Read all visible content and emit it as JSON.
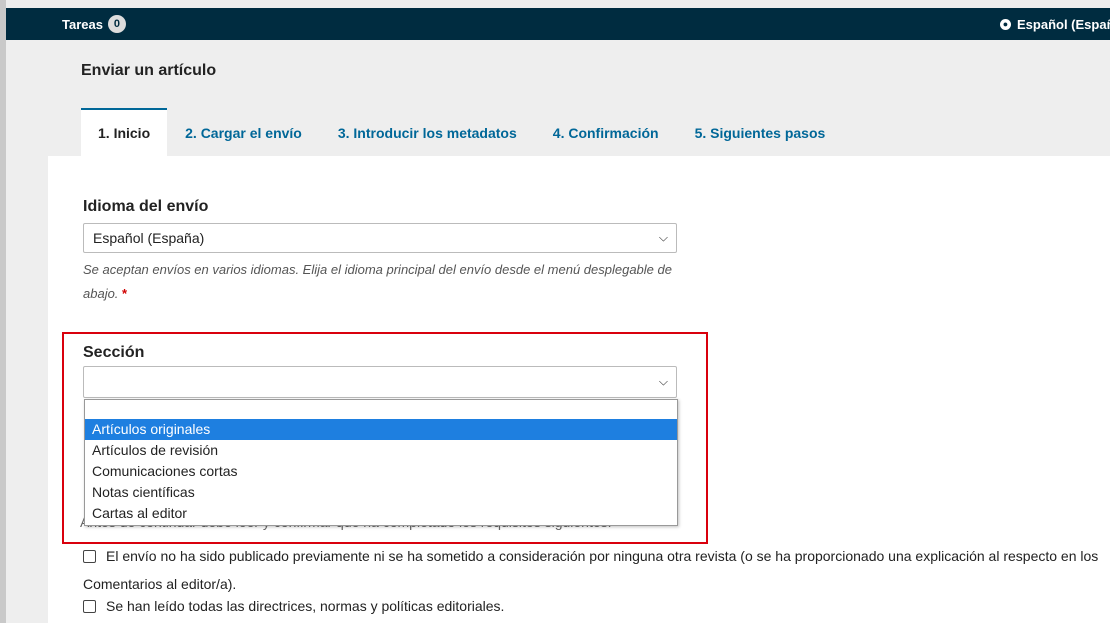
{
  "topbar": {
    "tasks_label": "Tareas",
    "tasks_count": "0",
    "language": "Español (España)"
  },
  "page": {
    "title": "Enviar un artículo"
  },
  "tabs": [
    {
      "label": "1. Inicio",
      "active": true
    },
    {
      "label": "2. Cargar el envío"
    },
    {
      "label": "3. Introducir los metadatos"
    },
    {
      "label": "4. Confirmación"
    },
    {
      "label": "5. Siguientes pasos"
    }
  ],
  "language_field": {
    "label": "Idioma del envío",
    "value": "Español (España)",
    "help": "Se aceptan envíos en varios idiomas. Elija el idioma principal del envío desde el menú desplegable de abajo.",
    "required_mark": "*"
  },
  "section_field": {
    "label": "Sección",
    "value": "",
    "options": [
      "",
      "Artículos originales",
      "Artículos de revisión",
      "Comunicaciones cortas",
      "Notas científicas",
      "Cartas al editor"
    ],
    "highlighted_option": "Artículos originales"
  },
  "requirements": {
    "intro": "Antes de continuar debe leer y confirmar que ha completado los requisitos siguientes.",
    "items": [
      {
        "text": "El envío no ha sido publicado previamente ni se ha sometido a consideración por ninguna otra revista (o se ha proporcionado una explicación al respecto en los",
        "continuation": "Comentarios al editor/a)."
      },
      {
        "text": "Se han leído todas las directrices, normas y políticas editoriales."
      }
    ]
  },
  "colors": {
    "topbar": "#002c40",
    "link": "#006798",
    "highlight_border": "#d9000d",
    "selected_option": "#1e7fe0"
  }
}
